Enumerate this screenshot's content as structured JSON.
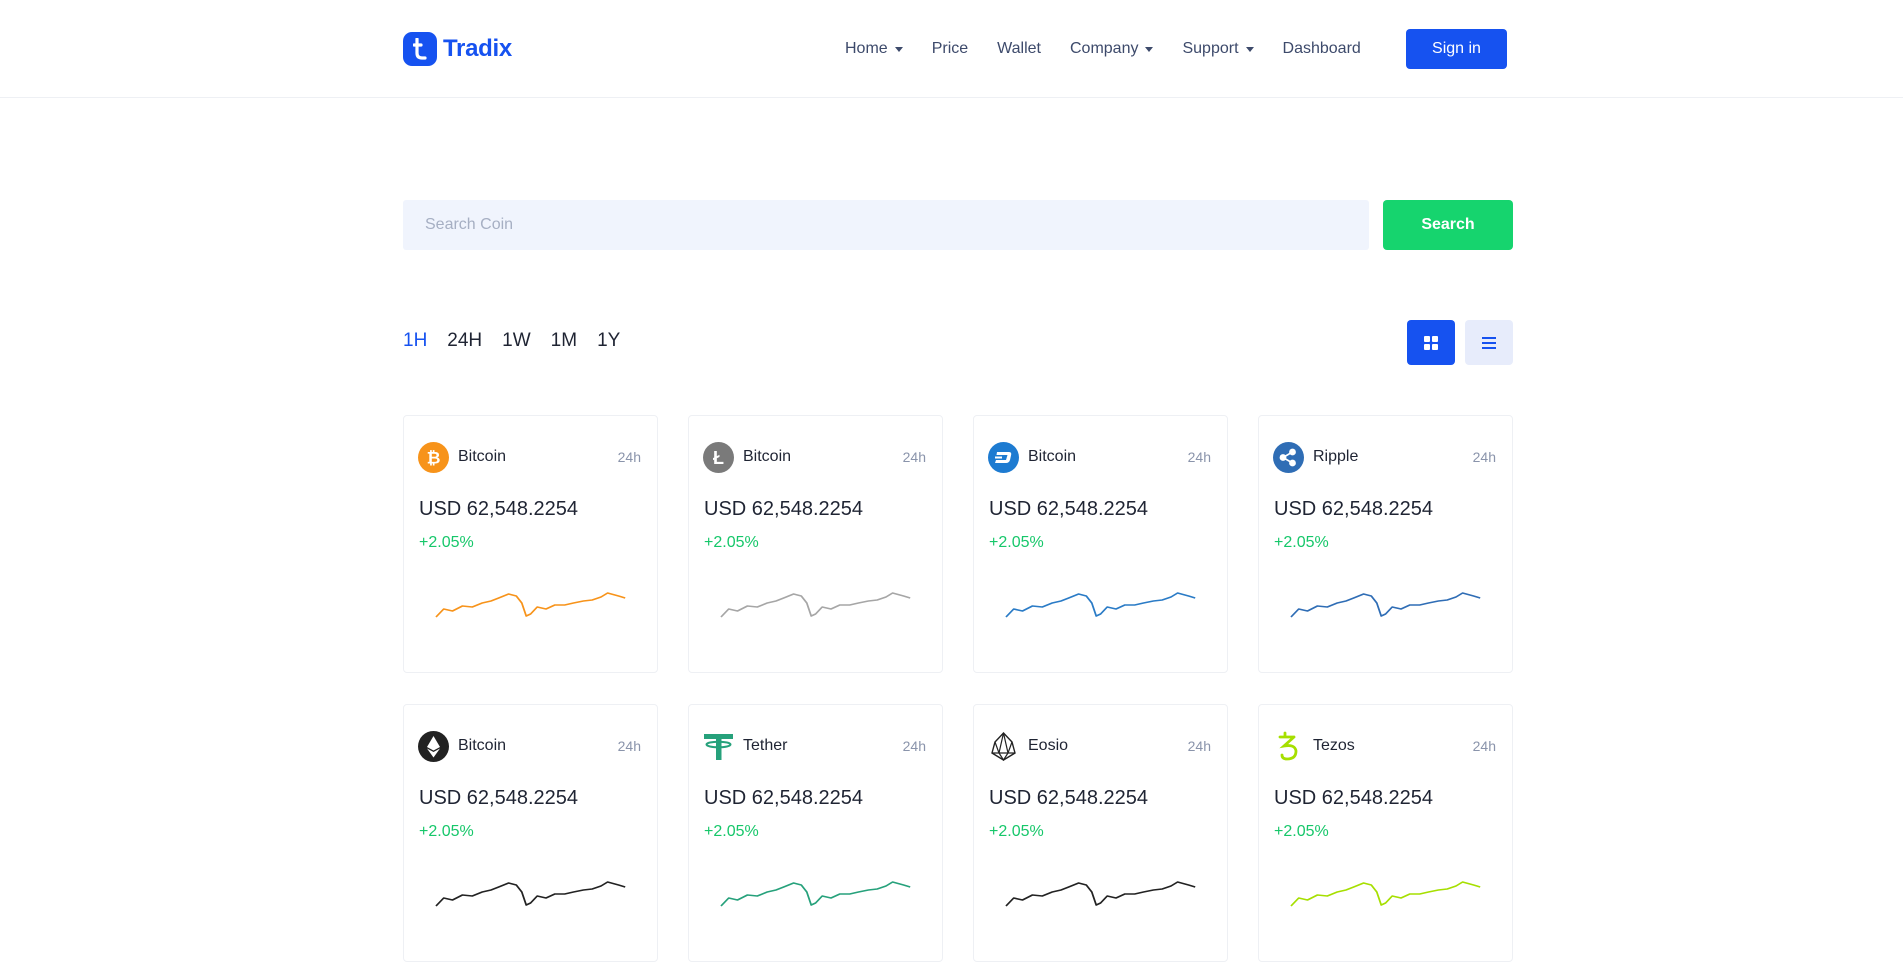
{
  "brand": {
    "name": "Tradix",
    "color": "#1652f0"
  },
  "nav": {
    "items": [
      {
        "label": "Home",
        "dropdown": true
      },
      {
        "label": "Price",
        "dropdown": false
      },
      {
        "label": "Wallet",
        "dropdown": false
      },
      {
        "label": "Company",
        "dropdown": true
      },
      {
        "label": "Support",
        "dropdown": true
      },
      {
        "label": "Dashboard",
        "dropdown": false
      }
    ],
    "signin_label": "Sign in"
  },
  "search": {
    "placeholder": "Search Coin",
    "value": "",
    "button_label": "Search"
  },
  "periods": {
    "items": [
      "1H",
      "24H",
      "1W",
      "1M",
      "1Y"
    ],
    "active": "1H"
  },
  "view_toggle": {
    "active": "grid",
    "grid_icon": "grid-icon",
    "list_icon": "list-icon"
  },
  "colors": {
    "accent": "#1652f0",
    "positive": "#16c76a",
    "search_button": "#16d46e"
  },
  "coins": [
    {
      "name": "Bitcoin",
      "period": "24h",
      "price": "USD 62,548.2254",
      "change": "+2.05%",
      "icon": "bitcoin-icon",
      "color": "#f7931a"
    },
    {
      "name": "Bitcoin",
      "period": "24h",
      "price": "USD 62,548.2254",
      "change": "+2.05%",
      "icon": "litecoin-icon",
      "color": "#a6a6a6"
    },
    {
      "name": "Bitcoin",
      "period": "24h",
      "price": "USD 62,548.2254",
      "change": "+2.05%",
      "icon": "dash-icon",
      "color": "#2a7bc6"
    },
    {
      "name": "Ripple",
      "period": "24h",
      "price": "USD 62,548.2254",
      "change": "+2.05%",
      "icon": "ripple-icon",
      "color": "#2f6db5"
    },
    {
      "name": "Bitcoin",
      "period": "24h",
      "price": "USD 62,548.2254",
      "change": "+2.05%",
      "icon": "ethereum-icon",
      "color": "#222222"
    },
    {
      "name": "Tether",
      "period": "24h",
      "price": "USD 62,548.2254",
      "change": "+2.05%",
      "icon": "tether-icon",
      "color": "#26a17b"
    },
    {
      "name": "Eosio",
      "period": "24h",
      "price": "USD 62,548.2254",
      "change": "+2.05%",
      "icon": "eos-icon",
      "color": "#222222"
    },
    {
      "name": "Tezos",
      "period": "24h",
      "price": "USD 62,548.2254",
      "change": "+2.05%",
      "icon": "tezos-icon",
      "color": "#a6df00"
    }
  ]
}
